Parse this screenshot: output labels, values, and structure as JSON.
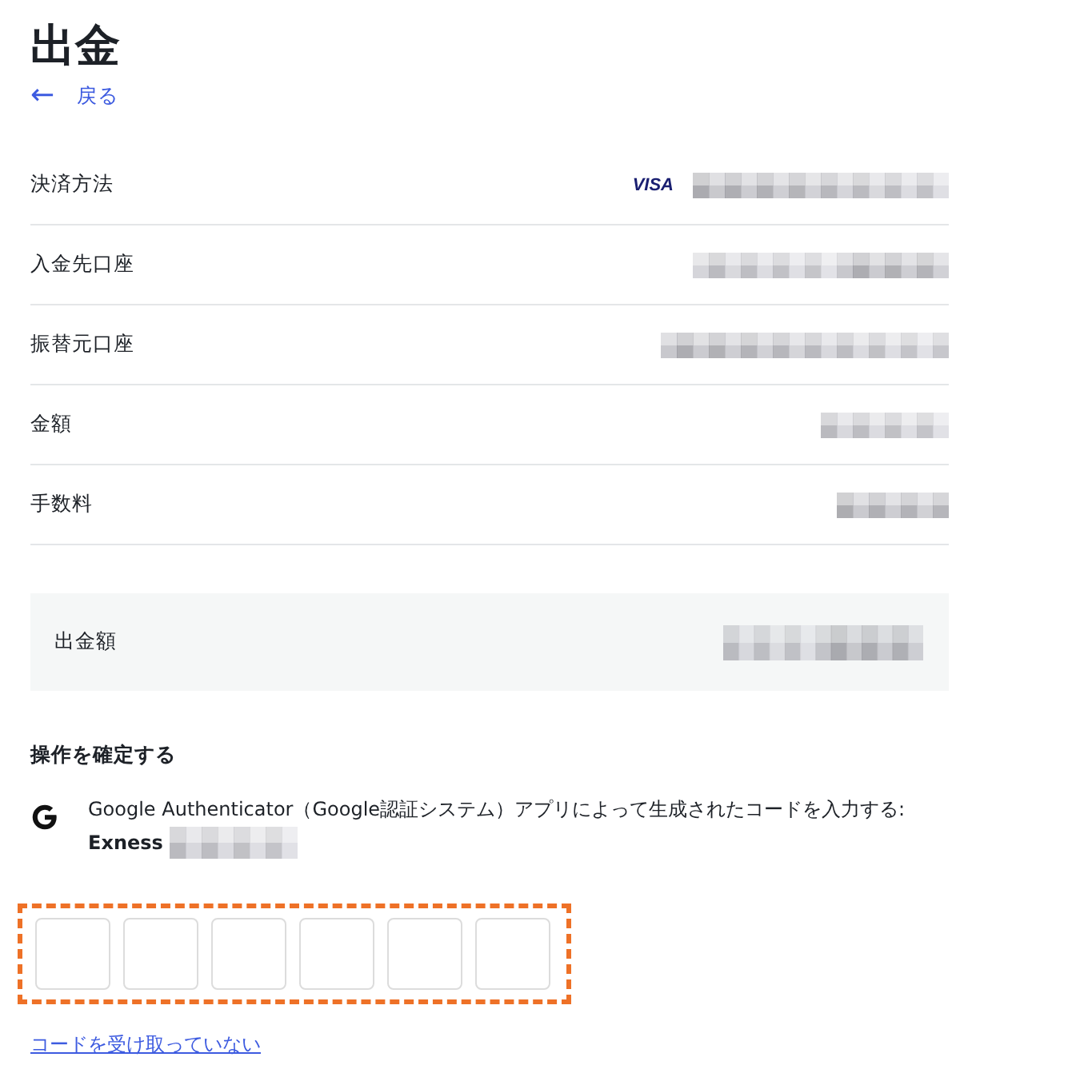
{
  "title": "出金",
  "back_link": {
    "arrow": "←",
    "label": "戻る"
  },
  "details": [
    {
      "label": "決済方法",
      "card_brand": "VISA",
      "value_redacted": true
    },
    {
      "label": "入金先口座",
      "value_redacted": true
    },
    {
      "label": "振替元口座",
      "value_redacted": true
    },
    {
      "label": "金額",
      "value_redacted": true
    },
    {
      "label": "手数料",
      "value_redacted": true
    }
  ],
  "total": {
    "label": "出金額",
    "value_redacted": true
  },
  "confirm": {
    "heading": "操作を確定する",
    "instruction": "Google Authenticator（Google認証システム）アプリによって生成されたコードを入力する:",
    "account_name": "Exness",
    "account_id_redacted": true
  },
  "code_inputs": {
    "highlighted": true,
    "boxes": [
      {
        "filled": false
      },
      {
        "filled": false
      },
      {
        "filled": false
      },
      {
        "filled": false
      },
      {
        "filled": false
      },
      {
        "filled": false
      }
    ]
  },
  "resend_link": "コードを受け取っていない"
}
